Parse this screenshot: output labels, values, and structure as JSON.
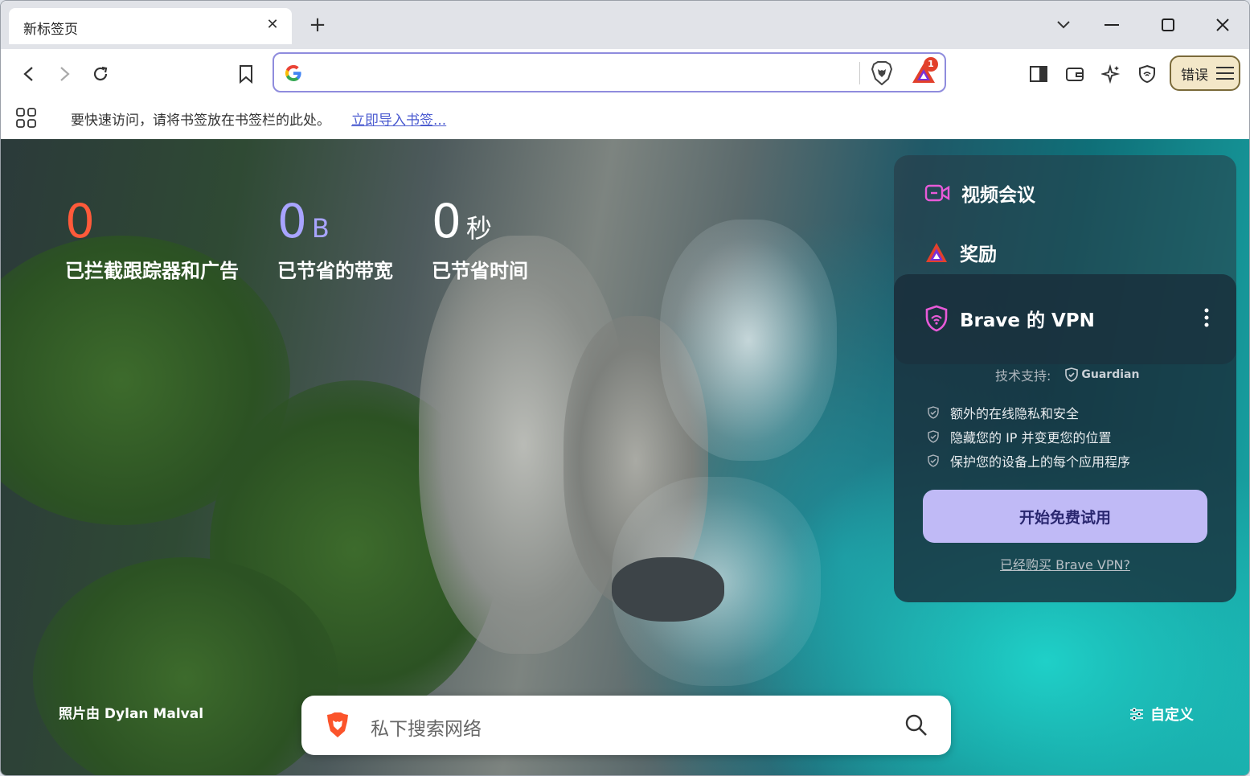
{
  "tab": {
    "title": "新标签页"
  },
  "bookmarks": {
    "hint": "要快速访问，请将书签放在书签栏的此处。",
    "import_link": "立即导入书签..."
  },
  "toolbar": {
    "error_label": "错误",
    "badge_count": "1"
  },
  "stats": [
    {
      "value": "0",
      "unit": "",
      "label": "已拦截跟踪器和广告",
      "color": "#ff5a3a"
    },
    {
      "value": "0",
      "unit": "B",
      "label": "已节省的带宽",
      "color": "#a8a4ff"
    },
    {
      "value": "0",
      "unit": "秒",
      "label": "已节省时间",
      "color": "#ffffff"
    }
  ],
  "widgets": {
    "video": "视频会议",
    "rewards": "奖励"
  },
  "vpn": {
    "title": "Brave 的 VPN",
    "support_label": "技术支持:",
    "support_brand": "Guardian",
    "features": [
      "额外的在线隐私和安全",
      "隐藏您的 IP 并变更您的位置",
      "保护您的设备上的每个应用程序"
    ],
    "cta": "开始免费试用",
    "purchased_link": "已经购买 Brave VPN?"
  },
  "photo_credit": "照片由 Dylan Malval",
  "customize": "自定义",
  "search": {
    "placeholder": "私下搜索网络"
  },
  "colors": {
    "accent": "#8f8cdd",
    "vpn_button": "#c0baf6",
    "brave_orange": "#fb542b"
  }
}
